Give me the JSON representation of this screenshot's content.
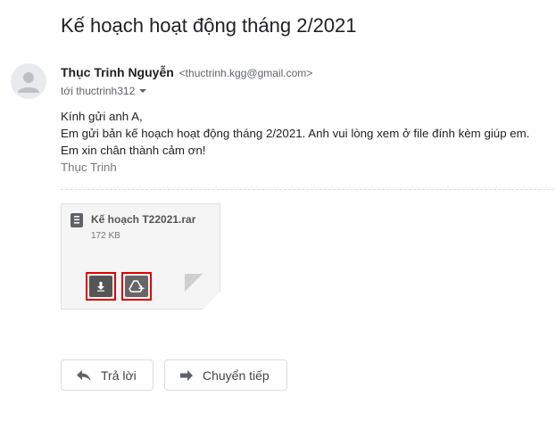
{
  "email": {
    "subject": "Kế hoạch hoạt động tháng 2/2021",
    "sender_name": "Thục Trinh Nguyễn",
    "sender_email": "<thuctrinh.kgg@gmail.com>",
    "recipient": "tới thuctrinh312",
    "body": {
      "line1": "Kính gửi anh A,",
      "line2": "Em gửi bản kế hoạch hoạt động tháng 2/2021. Anh vui lòng xem ở file đính kèm giúp em.",
      "line3": "Em xin chân thành cảm ơn!",
      "signature": "Thục Trinh"
    }
  },
  "attachment": {
    "name": "Kế hoạch T22021.rar",
    "size": "172 KB",
    "icon": "archive-file-icon",
    "actions": [
      "download-icon",
      "save-to-drive-icon"
    ],
    "highlight_color": "#e00000"
  },
  "actions": {
    "reply_label": "Trả lời",
    "forward_label": "Chuyển tiếp"
  }
}
